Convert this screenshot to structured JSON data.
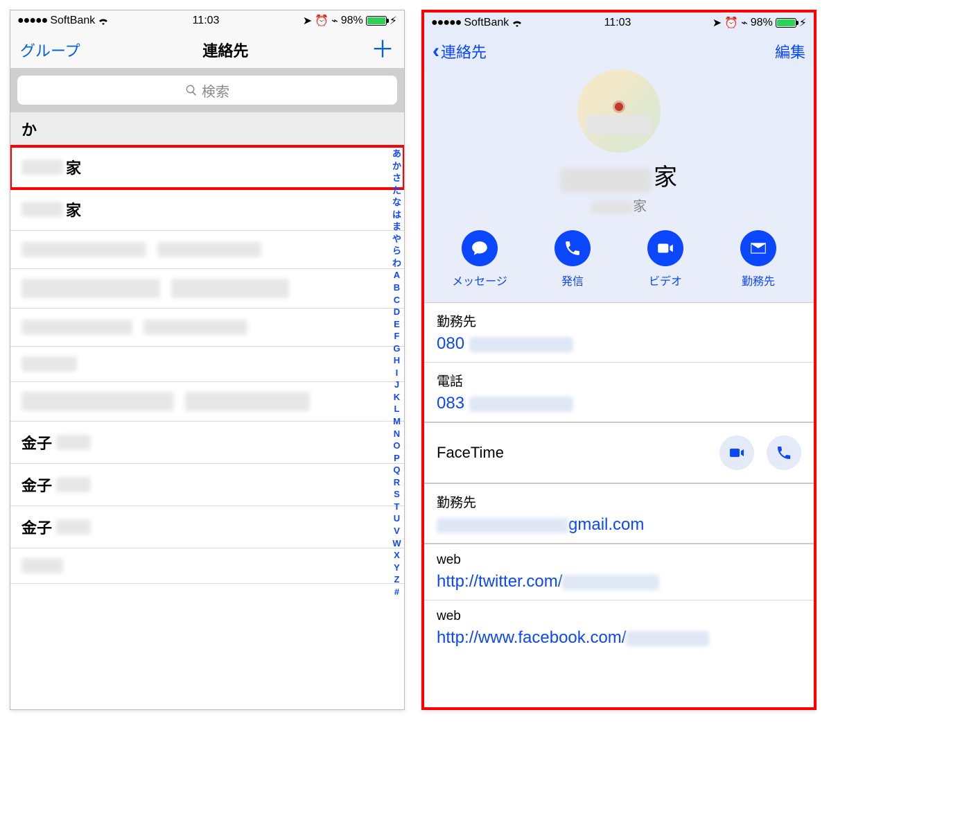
{
  "status": {
    "carrier": "SoftBank",
    "signal_dots": "●●●●●",
    "time": "11:03",
    "battery_pct": "98%"
  },
  "left": {
    "nav": {
      "groups": "グループ",
      "title": "連絡先",
      "add": "＋"
    },
    "search": {
      "placeholder": "検索"
    },
    "section": "か",
    "rows": {
      "r1_suffix": "家",
      "r2_suffix": "家",
      "r8_prefix": "金子",
      "r9_prefix": "金子",
      "r10_prefix": "金子"
    },
    "index": [
      "あ",
      "か",
      "さ",
      "た",
      "な",
      "は",
      "ま",
      "や",
      "ら",
      "わ",
      "A",
      "B",
      "C",
      "D",
      "E",
      "F",
      "G",
      "H",
      "I",
      "J",
      "K",
      "L",
      "M",
      "N",
      "O",
      "P",
      "Q",
      "R",
      "S",
      "T",
      "U",
      "V",
      "W",
      "X",
      "Y",
      "Z",
      "#"
    ]
  },
  "right": {
    "nav": {
      "back": "連絡先",
      "edit": "編集"
    },
    "profile": {
      "name_suffix": "家",
      "sub_suffix": "家"
    },
    "actions": {
      "message": "メッセージ",
      "call": "発信",
      "video": "ビデオ",
      "mail": "勤務先"
    },
    "items": {
      "work_phone_label": "勤務先",
      "work_phone_prefix": "080",
      "phone_label": "電話",
      "phone_prefix": "083",
      "facetime": "FaceTime",
      "work_email_label": "勤務先",
      "work_email_suffix": "gmail.com",
      "web1_label": "web",
      "web1_prefix": "http://twitter.com/",
      "web2_label": "web",
      "web2_prefix": "http://www.facebook.com/"
    }
  }
}
